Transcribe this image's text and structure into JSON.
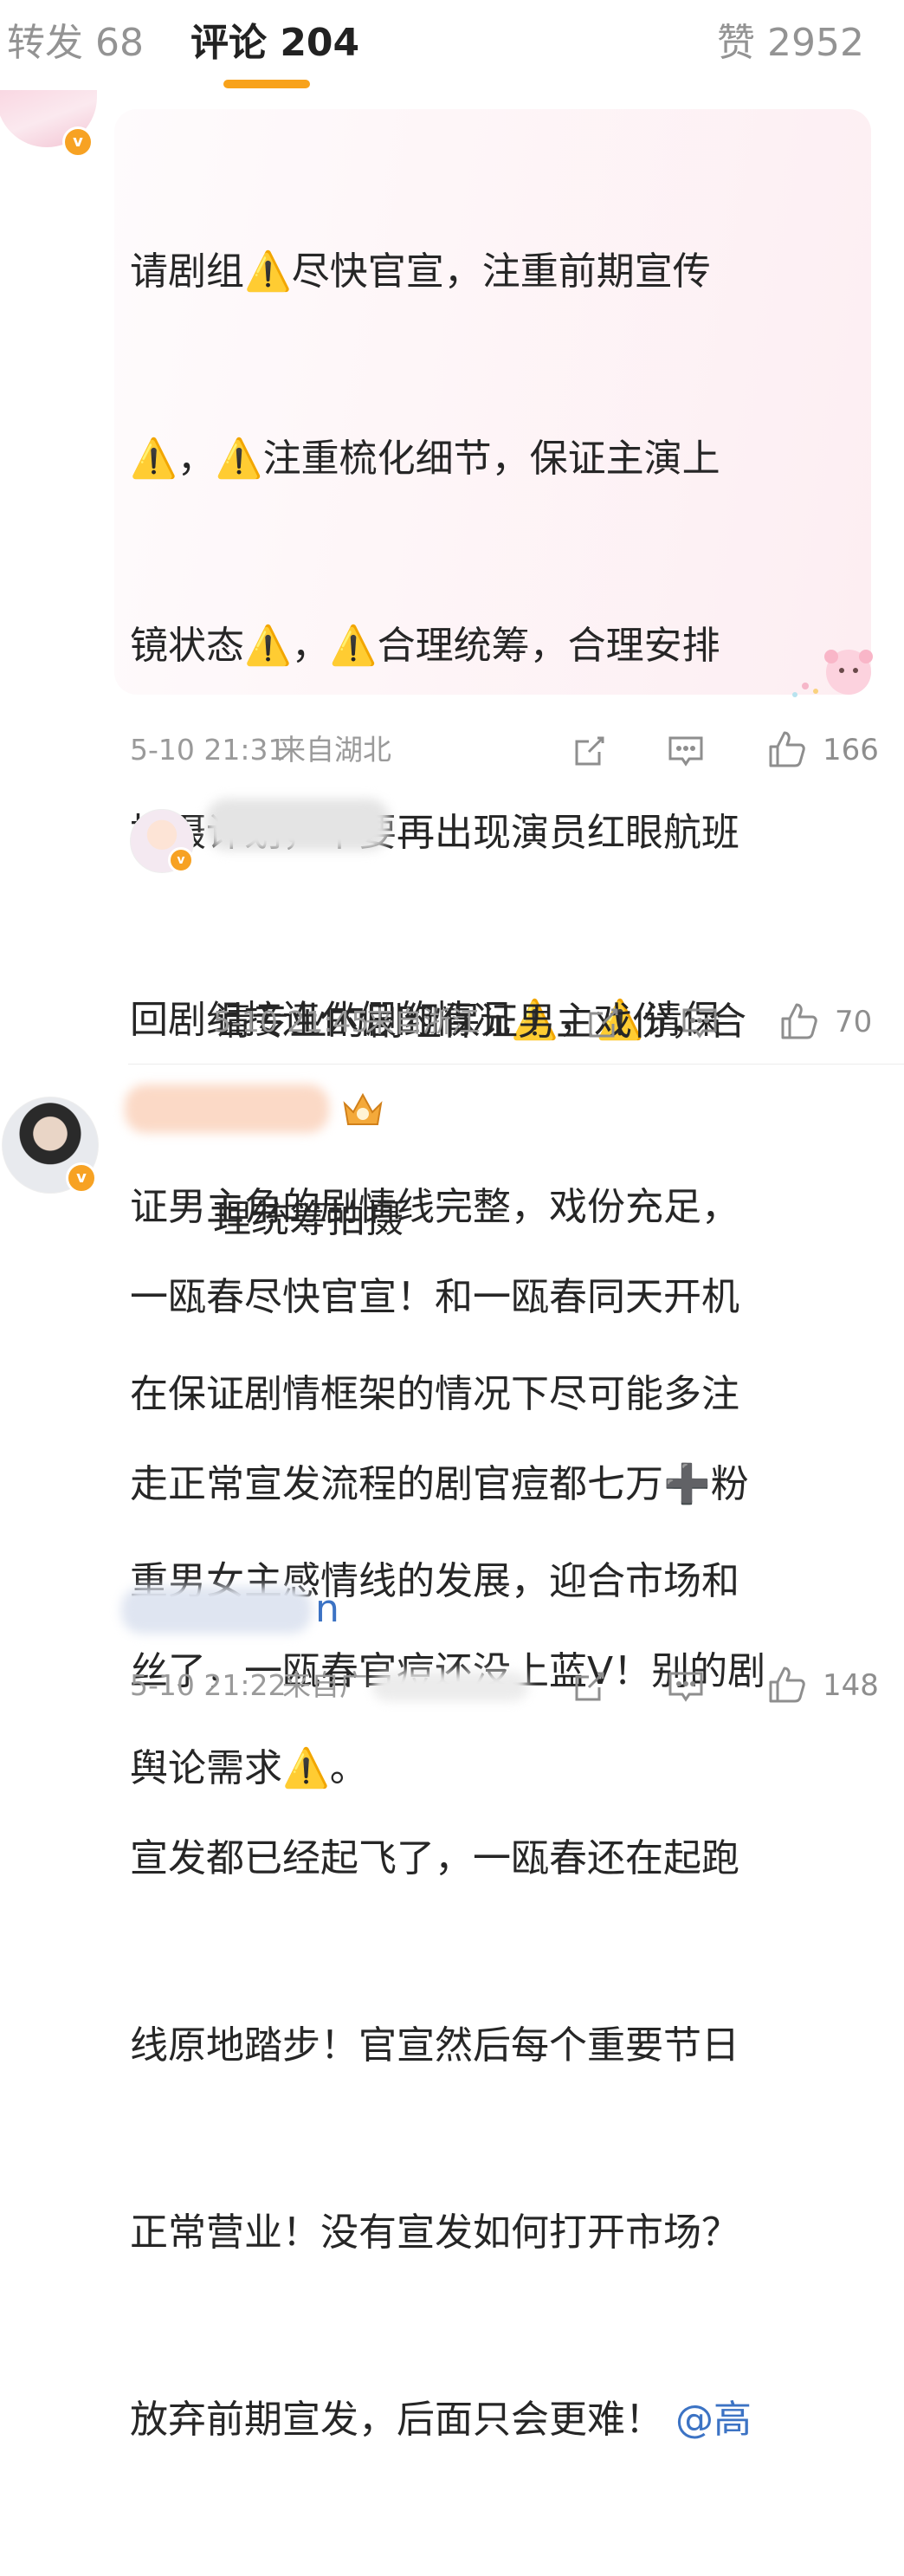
{
  "tabs": {
    "repost": "转发 68",
    "comments": "评论 204",
    "likes": "赞 2952"
  },
  "comments": [
    {
      "text": "请剧组⚠️尽快官宣，注重前期宣传⚠️，⚠️注重梳化细节，保证主演上镜状态⚠️，⚠️合理统筹，合理安排拍摄计划，不要再出现演员红眼航班回剧组接连休假的情况⚠️，⚠️请保证男主角的剧情线完整，戏份充足，在保证剧情框架的情况下尽可能多注重男女主感情线的发展，迎合市场和舆论需求⚠️。",
      "lines": [
        "请剧组⚠️尽快官宣，注重前期宣传",
        "⚠️，⚠️注重梳化细节，保证主演上",
        "镜状态⚠️，⚠️合理统筹，合理安排",
        "拍摄计划，不要再出现演员红眼航班",
        "回剧组接连休假的情况⚠️，⚠️请保",
        "证男主角的剧情线完整，戏份充足，",
        "在保证剧情框架的情况下尽可能多注",
        "重男女主感情线的发展，迎合市场和",
        "舆论需求⚠️。"
      ],
      "time": "5-10 21:31",
      "location": "来自湖北",
      "likes": "166"
    },
    {
      "lines": [
        "请专业的剧组保证男主戏份，合",
        "理统筹拍摄"
      ],
      "time": "5-10 21:45",
      "location": "来自浙江",
      "likes": "70"
    },
    {
      "lines": [
        "一瓯春尽快官宣！和一瓯春同天开机",
        "走正常宣发流程的剧官痘都七万➕粉",
        "丝了，一瓯春官痘还没上蓝V！别的剧",
        "宣发都已经起飞了，一瓯春还在起跑",
        "线原地踏步！官宣然后每个重要节日",
        "正常营业！没有宣发如何打开市场？",
        "放弃前期宣发，后面只会更难！"
      ],
      "mention": "@高",
      "mention_tail": "n",
      "time": "5-10 21:22",
      "location": "来自广",
      "likes": "148"
    }
  ],
  "icons": {
    "share": "share-icon",
    "reply": "comment-icon",
    "like": "thumbs-up-icon",
    "verified": "verified-badge-icon",
    "crown": "crown-badge-icon"
  },
  "colors": {
    "accent": "#f8a21a",
    "mention": "#3c73c4",
    "meta": "#9a9a9a"
  }
}
